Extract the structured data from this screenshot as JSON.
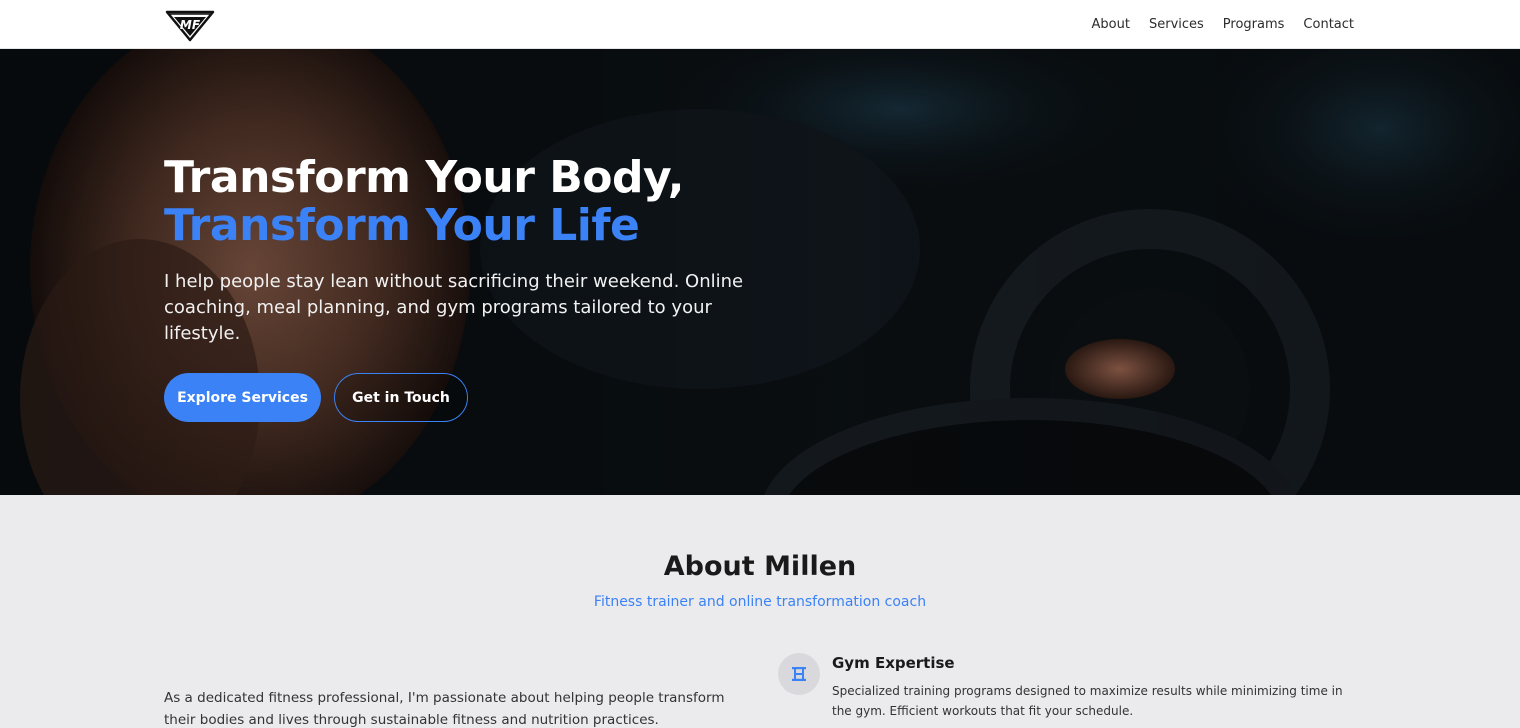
{
  "header": {
    "logo_text": "MF",
    "logo_alt": "MF logo",
    "nav": [
      {
        "label": "About"
      },
      {
        "label": "Services"
      },
      {
        "label": "Programs"
      },
      {
        "label": "Contact"
      }
    ]
  },
  "hero": {
    "title_line1": "Transform Your Body,",
    "title_line2": "Transform Your Life",
    "subtitle": "I help people stay lean without sacrificing their weekend. Online coaching, meal planning, and gym programs tailored to your lifestyle.",
    "primary_button": "Explore Services",
    "secondary_button": "Get in Touch"
  },
  "about": {
    "title": "About Millen",
    "subtitle": "Fitness trainer and online transformation coach",
    "text": "As a dedicated fitness professional, I'm passionate about helping people transform their bodies and lives through sustainable fitness and nutrition practices.",
    "feature": {
      "icon": "dumbbell-icon",
      "title": "Gym Expertise",
      "description": "Specialized training programs designed to maximize results while minimizing time in the gym. Efficient workouts that fit your schedule."
    }
  },
  "colors": {
    "accent": "#3b82f6",
    "header_bg": "#ffffff",
    "section_bg": "#ebebed",
    "hero_bg": "#0b0f12"
  }
}
